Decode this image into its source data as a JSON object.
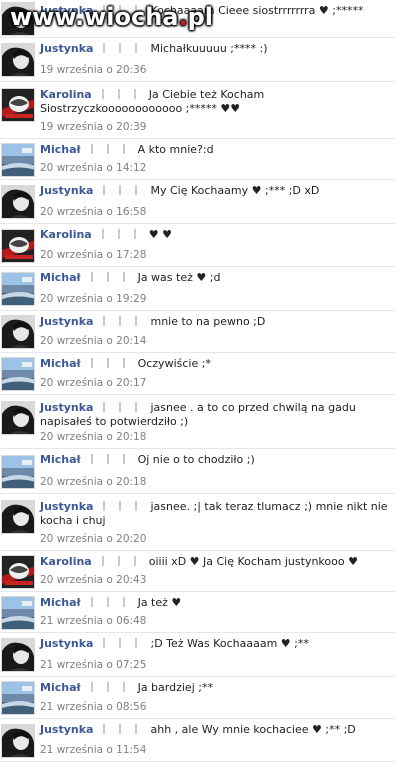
{
  "watermark": {
    "pre": "www.wiocha",
    "dot": ".",
    "post": "pl"
  },
  "messages": [
    {
      "author": "Justynka",
      "avatar": "dark",
      "text": "Kochaaaam Cieee siostrrrrrrra ♥ ;*****",
      "time": ""
    },
    {
      "author": "Justynka",
      "avatar": "dark",
      "text": "Michałkuuuuu ;**** :)",
      "time": "19 września o 20:36"
    },
    {
      "author": "Karolina",
      "avatar": "red",
      "text": "Ja Ciebie też Kocham Siostrzyczkoooooooooooo ;***** ♥♥",
      "time": "19 września o 20:39"
    },
    {
      "author": "Michał",
      "avatar": "landscape",
      "text": "A kto mnie?:d",
      "time": "20 września o 14:12"
    },
    {
      "author": "Justynka",
      "avatar": "dark",
      "text": "My Cię Kochaamy ♥ ;*** ;D xD",
      "time": "20 września o 16:58"
    },
    {
      "author": "Karolina",
      "avatar": "red",
      "text": "♥ ♥",
      "time": "20 września o 17:28"
    },
    {
      "author": "Michał",
      "avatar": "landscape",
      "text": "Ja was też ♥ ;d",
      "time": "20 września o 19:29"
    },
    {
      "author": "Justynka",
      "avatar": "dark",
      "text": "mnie to na pewno ;D",
      "time": "20 września o 20:14"
    },
    {
      "author": "Michał",
      "avatar": "landscape",
      "text": "Oczywiście ;*",
      "time": "20 września o 20:17"
    },
    {
      "author": "Justynka",
      "avatar": "dark",
      "text": "jasnee . a to co przed chwilą na gadu napisałeś to potwierdziło ;)",
      "time": "20 września o 20:18"
    },
    {
      "author": "Michał",
      "avatar": "landscape",
      "text": "Oj nie o to chodziło ;)",
      "time": "20 września o 20:18"
    },
    {
      "author": "Justynka",
      "avatar": "dark",
      "text": "jasnee. ;| tak teraz tlumacz ;) mnie nikt nie kocha i chuj",
      "time": "20 września o 20:20"
    },
    {
      "author": "Karolina",
      "avatar": "red",
      "text": "oiiii xD ♥ Ja Cię Kocham justynkooo ♥",
      "time": "20 września o 20:43"
    },
    {
      "author": "Michał",
      "avatar": "landscape",
      "text": "Ja też ♥",
      "time": "21 września o 06:48"
    },
    {
      "author": "Justynka",
      "avatar": "dark",
      "text": ";D Też Was Kochaaaam ♥ ;**",
      "time": "21 września o 07:25"
    },
    {
      "author": "Michał",
      "avatar": "landscape",
      "text": "Ja bardziej ;**",
      "time": "21 września o 08:56"
    },
    {
      "author": "Justynka",
      "avatar": "dark",
      "text": "ahh , ale Wy mnie kochaciee ♥ ;** ;D",
      "time": "21 września o 11:54"
    }
  ],
  "colors": {
    "name": "#3b5998",
    "time": "#808080",
    "divider": "#e4e7ee"
  }
}
